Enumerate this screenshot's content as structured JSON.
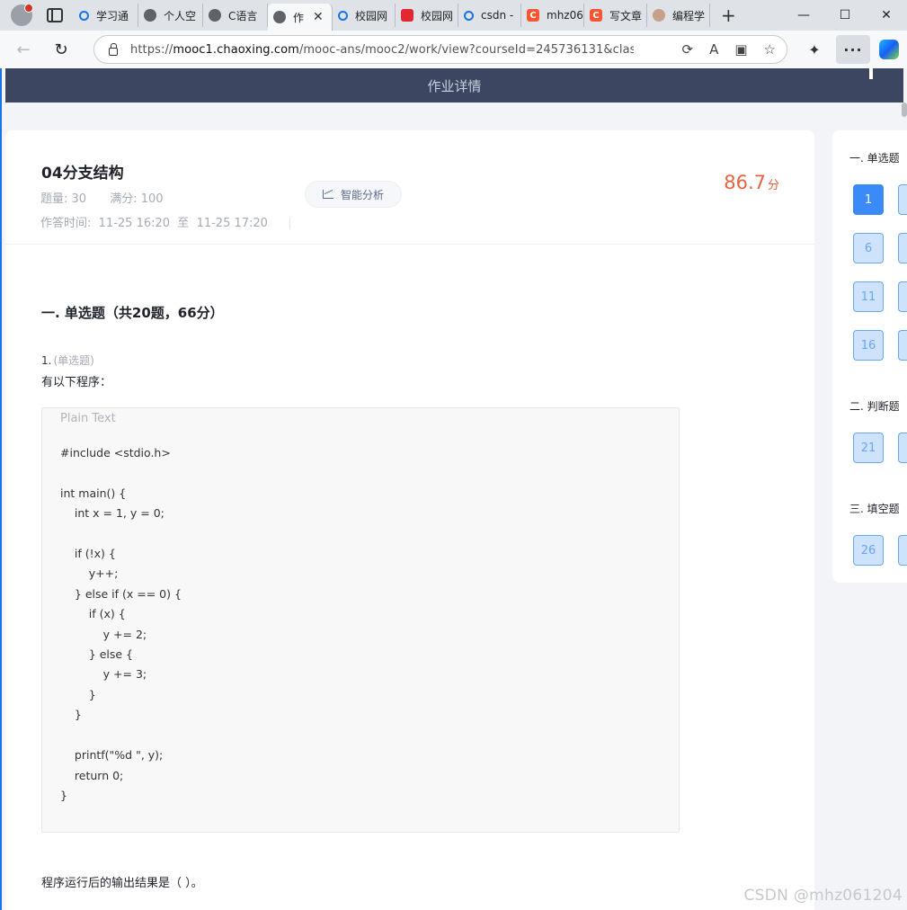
{
  "browser": {
    "tabs": [
      {
        "label": "学习通",
        "icon": "search-icon"
      },
      {
        "label": "个人空",
        "icon": "globe-icon"
      },
      {
        "label": "C语言",
        "icon": "globe-icon"
      },
      {
        "label": "作",
        "icon": "globe-icon",
        "active": true
      },
      {
        "label": "校园网",
        "icon": "search-icon"
      },
      {
        "label": "校园网",
        "icon": "cloud-icon"
      },
      {
        "label": "csdn -",
        "icon": "search-icon"
      },
      {
        "label": "mhz06",
        "icon": "csdn-icon"
      },
      {
        "label": "写文章",
        "icon": "csdn-icon"
      },
      {
        "label": "编程学",
        "icon": "avatar-icon"
      }
    ],
    "tab_close": "✕",
    "new_tab": "+",
    "url_prefix": "https://",
    "url_host": "mooc1.chaoxing.com",
    "url_path": "/mooc-ans/mooc2/work/view?courseId=245736131&classId..."
  },
  "page": {
    "header_title": "作业详情",
    "homework": {
      "title": "04分支结构",
      "count_label": "题量: 30",
      "full_score_label": "满分: 100",
      "time_label": "作答时间:",
      "time_start": "11-25 16:20",
      "time_to": "至",
      "time_end": "11-25 17:20",
      "ai_button": "智能分析",
      "score": "86.7",
      "score_unit": "分"
    },
    "section_title": "一. 单选题（共20题，66分）",
    "question": {
      "number": "1.",
      "type": "(单选题)",
      "stem": "有以下程序：",
      "code_lang": "Plain Text",
      "code": "#include <stdio.h>\n\nint main() {\n    int x = 1, y = 0;\n\n    if (!x) {\n        y++;\n    } else if (x == 0) {\n        if (x) {\n            y += 2;\n        } else {\n            y += 3;\n        }\n    }\n\n    printf(\"%d \", y);\n    return 0;\n}",
      "ask": "程序运行后的输出结果是（ ）。"
    }
  },
  "answer_sheet": {
    "groups": [
      {
        "title": "一. 单选题",
        "numbers": [
          "1",
          "6",
          "11",
          "16"
        ]
      },
      {
        "title": "二. 判断题",
        "numbers": [
          "21"
        ]
      },
      {
        "title": "三. 填空题",
        "numbers": [
          "26"
        ]
      }
    ]
  },
  "watermark": "CSDN @mhz061204"
}
